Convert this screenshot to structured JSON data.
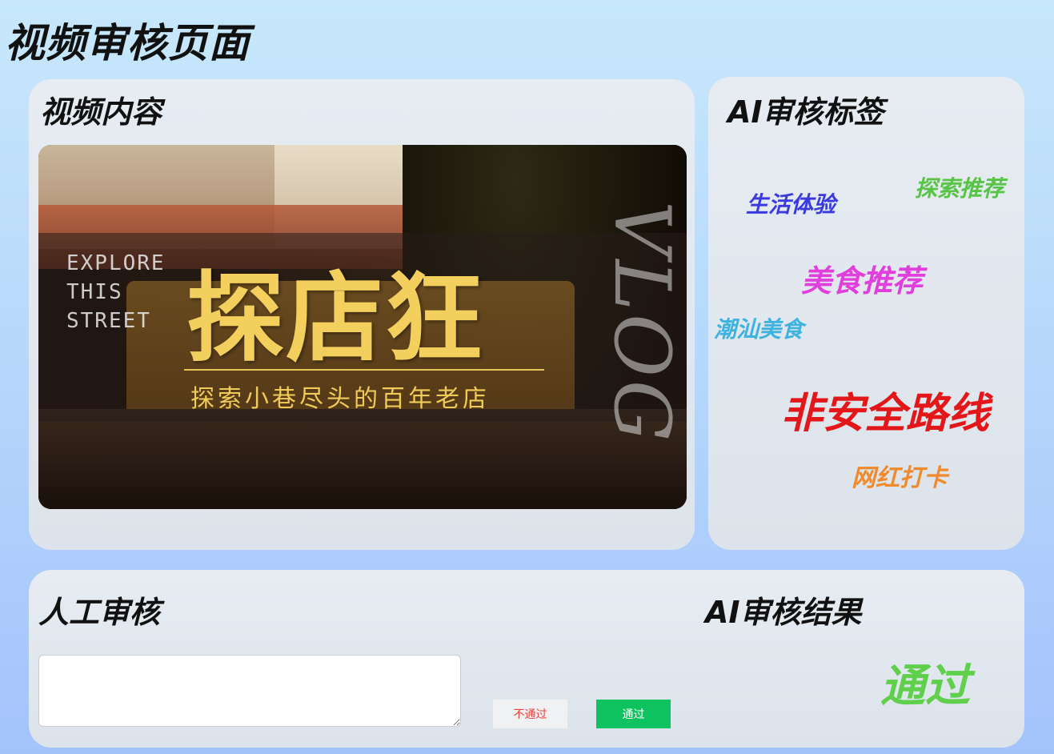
{
  "page": {
    "title": "视频审核页面"
  },
  "video_panel": {
    "heading": "视频内容",
    "thumbnail": {
      "side_text": "EXPLORE\nTHIS\nSTREET",
      "main_title": "探店狂",
      "subtitle": "探索小巷尽头的百年老店",
      "vertical_text": "VLOG"
    }
  },
  "tags_panel": {
    "heading": "AI审核标签",
    "tags": [
      {
        "label": "生活体验",
        "color": "#3a3adf"
      },
      {
        "label": "探索推荐",
        "color": "#58c446"
      },
      {
        "label": "美食推荐",
        "color": "#e03fdc"
      },
      {
        "label": "潮汕美食",
        "color": "#3fb3e0"
      },
      {
        "label": "非安全路线",
        "color": "#e3161a"
      },
      {
        "label": "网红打卡",
        "color": "#f08a2c"
      }
    ]
  },
  "review_panel": {
    "manual_heading": "人工审核",
    "input_value": "",
    "reject_label": "不通过",
    "pass_label": "通过",
    "ai_heading": "AI审核结果",
    "ai_result": "通过"
  }
}
